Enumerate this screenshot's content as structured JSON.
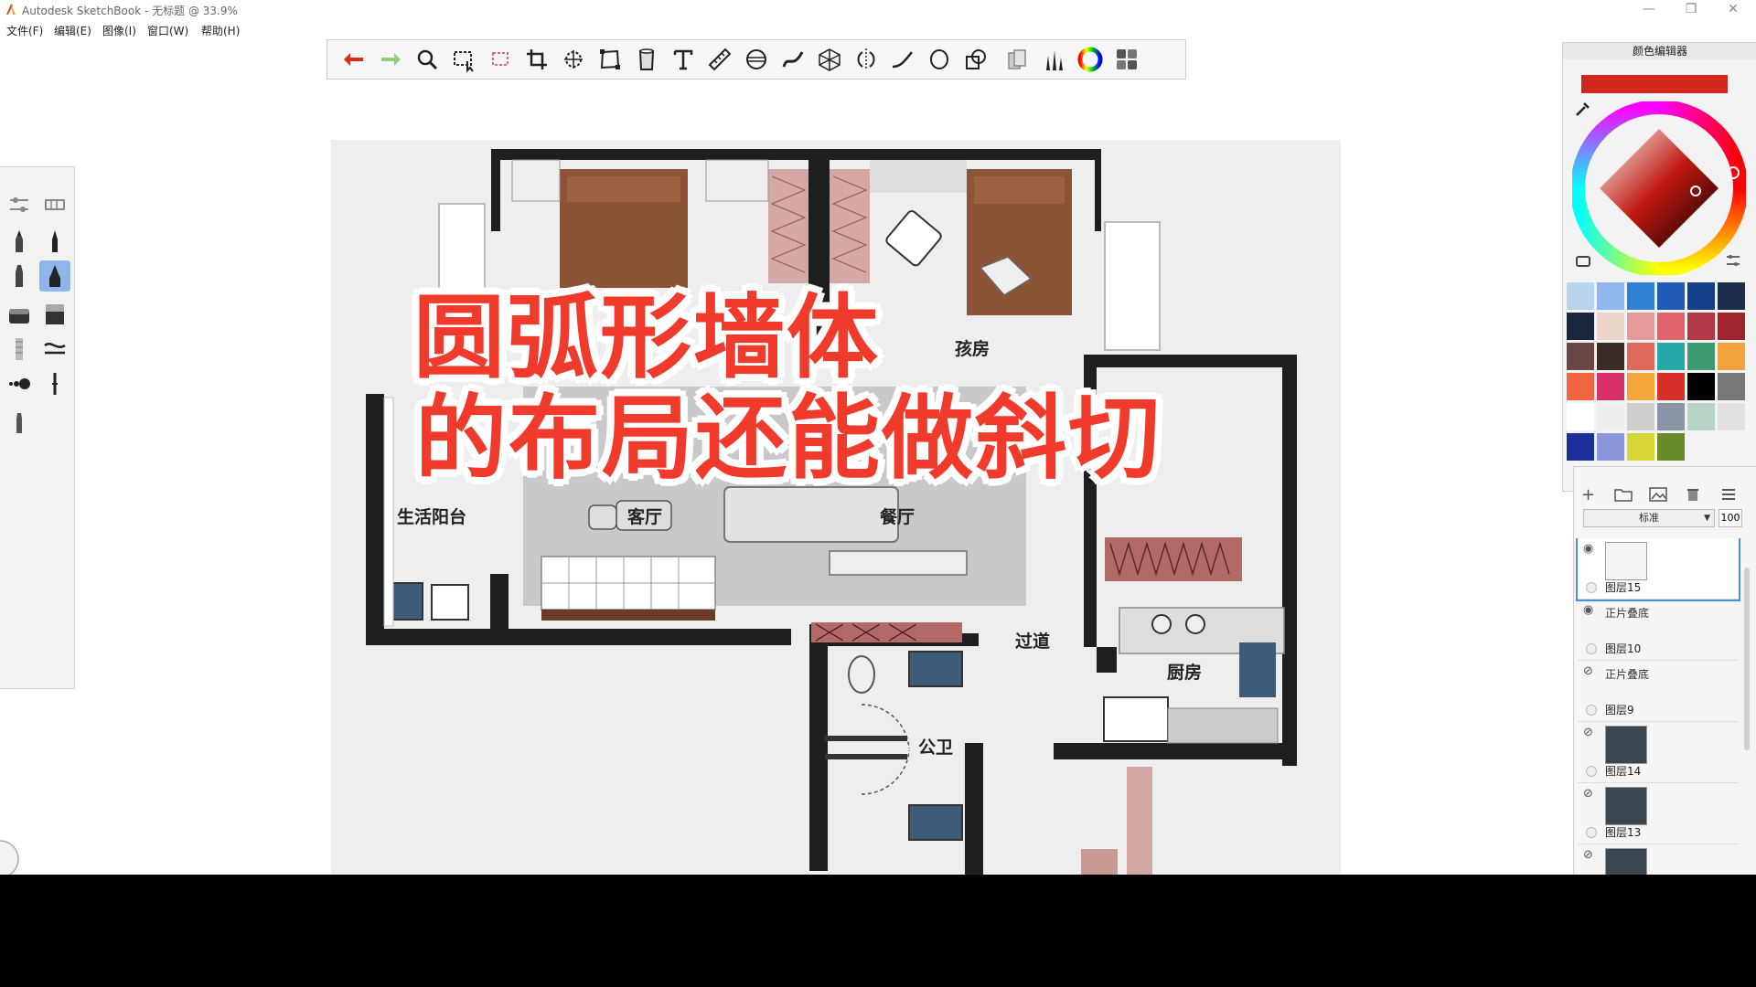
{
  "window": {
    "title": "Autodesk SketchBook - 无标题 @ 33.9%",
    "controls": [
      "—",
      "❐",
      "✕"
    ]
  },
  "menu": [
    "文件(F)",
    "编辑(E)",
    "图像(I)",
    "窗口(W)",
    "帮助(H)"
  ],
  "toolbar_icons": [
    "undo-icon",
    "redo-icon",
    "zoom-icon",
    "select-icon",
    "lasso-select-icon",
    "crop-icon",
    "transform-icon",
    "distort-icon",
    "fill-icon",
    "text-icon",
    "ruler-icon",
    "ellipse-guide-icon",
    "french-curve-icon",
    "perspective-icon",
    "symmetry-icon",
    "stroke-icon",
    "ellipse-icon",
    "shape-icon",
    "copic-icon",
    "brush-library-icon",
    "color-wheel-icon",
    "panel-toggle-icon"
  ],
  "canvas": {
    "room_labels": {
      "balcony": "生活阳台",
      "living": "客厅",
      "dining": "餐厅",
      "kids": "孩房",
      "corridor": "过道",
      "kitchen": "厨房",
      "bathroom": "公卫"
    },
    "headline": [
      "圆弧形墙体",
      "的布局还能做斜切"
    ]
  },
  "color_editor": {
    "title": "颜色编辑器",
    "current_color": "#d0261b",
    "swatches": [
      "#b8d4ee",
      "#8fb6ee",
      "#2f7fd6",
      "#1f5ab8",
      "#153f8c",
      "#1e2c4c",
      "#1c2540",
      "#ecd6cc",
      "#e89a9a",
      "#e0626a",
      "#b33846",
      "#a0242e",
      "#6b4646",
      "#3a2c26",
      "#e06a5a",
      "#26a8a8",
      "#3d9a72",
      "#f2a23a",
      "#f06440",
      "#d8306a",
      "#f5a63a",
      "#d83028",
      "#000000",
      "#777777",
      "#ffffff",
      "#ededed",
      "#cfcfcf",
      "#8a96a8",
      "#b8d4c4",
      "#e2e2e2",
      "#1c2f9a",
      "#8a96dc",
      "#d6d63a",
      "#6a8a2a",
      "",
      ""
    ]
  },
  "layers": {
    "blend_mode": "标准",
    "opacity": "100",
    "items": [
      {
        "name": "图层15",
        "visible": true,
        "blend": "",
        "selected": true
      },
      {
        "name": "图层10",
        "visible": true,
        "blend": "正片叠底",
        "selected": false
      },
      {
        "name": "图层9",
        "visible": false,
        "blend": "正片叠底",
        "selected": false
      },
      {
        "name": "图层14",
        "visible": false,
        "blend": "",
        "selected": false
      },
      {
        "name": "图层13",
        "visible": false,
        "blend": "",
        "selected": false
      },
      {
        "name": "",
        "visible": false,
        "blend": "",
        "selected": false
      }
    ]
  }
}
